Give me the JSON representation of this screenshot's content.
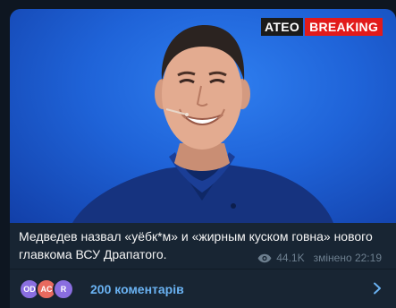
{
  "post": {
    "brand": {
      "logo": "ATEO",
      "badge": "BREAKING"
    },
    "caption": "Медведев назвал «уёбк*м» и «жирным куском говна» нового главкома ВСУ Драпатого.",
    "views": "44.1K",
    "edited_time": "змінено 22:19"
  },
  "comments": {
    "label": "200 коментарів",
    "avatars": [
      "OD",
      "AC",
      "R"
    ]
  },
  "colors": {
    "page_bg": "#0e1621",
    "bubble_bg": "#182533",
    "link": "#6ab2f2",
    "meta": "#6d7f8f",
    "breaking_red": "#e21b1b"
  },
  "icons": [
    "eye-icon",
    "chevron-right-icon"
  ]
}
